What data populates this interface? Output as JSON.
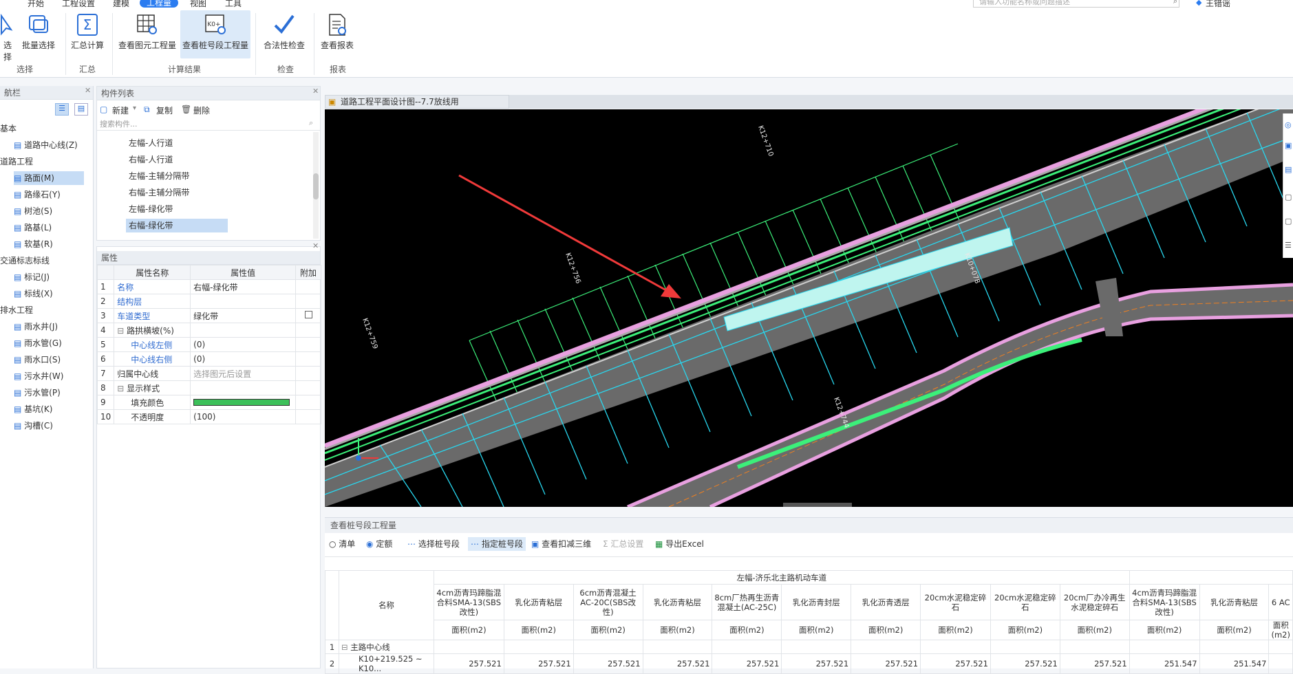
{
  "menu": {
    "items": [
      "开始",
      "工程设置",
      "建模",
      "工程量",
      "视图",
      "工具"
    ],
    "active_index": 3
  },
  "search": {
    "placeholder": "请输入功能名称或问题描述"
  },
  "user": {
    "name": "王错谣"
  },
  "ribbon": {
    "buttons": [
      "选择",
      "批量选择",
      "汇总计算",
      "查看图元工程量",
      "查看桩号段工程量",
      "合法性检查",
      "查看报表"
    ],
    "groups": [
      "选择",
      "汇总",
      "计算结果",
      "检查",
      "报表"
    ]
  },
  "nav": {
    "title": "航栏",
    "items": [
      {
        "label": "基本",
        "type": "category"
      },
      {
        "label": "道路中心线(Z)",
        "type": "item"
      },
      {
        "label": "道路工程",
        "type": "category"
      },
      {
        "label": "路面(M)",
        "type": "item",
        "selected": true
      },
      {
        "label": "路缘石(Y)",
        "type": "item"
      },
      {
        "label": "树池(S)",
        "type": "item"
      },
      {
        "label": "路基(L)",
        "type": "item"
      },
      {
        "label": "软基(R)",
        "type": "item"
      },
      {
        "label": "交通标志标线",
        "type": "category"
      },
      {
        "label": "标记(J)",
        "type": "item"
      },
      {
        "label": "标线(X)",
        "type": "item"
      },
      {
        "label": "排水工程",
        "type": "category"
      },
      {
        "label": "雨水井(J)",
        "type": "item"
      },
      {
        "label": "雨水管(G)",
        "type": "item"
      },
      {
        "label": "雨水口(S)",
        "type": "item"
      },
      {
        "label": "污水井(W)",
        "type": "item"
      },
      {
        "label": "污水管(P)",
        "type": "item"
      },
      {
        "label": "基坑(K)",
        "type": "item"
      },
      {
        "label": "沟槽(C)",
        "type": "item"
      }
    ]
  },
  "component_list": {
    "title": "构件列表",
    "new_label": "新建",
    "copy_label": "复制",
    "delete_label": "删除",
    "search_placeholder": "搜索构件...",
    "items": [
      "左幅-人行道",
      "右幅-人行道",
      "左幅-主辅分隔带",
      "右幅-主辅分隔带",
      "左幅-绿化带",
      "右幅-绿化带"
    ],
    "selected_index": 5
  },
  "properties": {
    "title": "属性",
    "headers": [
      "属性名称",
      "属性值",
      "附加"
    ],
    "rows": [
      {
        "no": "1",
        "name": "名称",
        "value": "右幅-绿化带",
        "blue": true
      },
      {
        "no": "2",
        "name": "结构层",
        "value": "",
        "blue": true
      },
      {
        "no": "3",
        "name": "车道类型",
        "value": "绿化带",
        "blue": true,
        "checkbox": true
      },
      {
        "no": "4",
        "name": "路拱横坡(%)",
        "value": "",
        "group": true
      },
      {
        "no": "5",
        "name": "中心线左侧",
        "value": "(0)",
        "blue": true,
        "indent": true
      },
      {
        "no": "6",
        "name": "中心线右侧",
        "value": "(0)",
        "blue": true,
        "indent": true
      },
      {
        "no": "7",
        "name": "归属中心线",
        "value": "选择图元后设置",
        "muted": true
      },
      {
        "no": "8",
        "name": "显示样式",
        "value": "",
        "group": true
      },
      {
        "no": "9",
        "name": "填充颜色",
        "value": "",
        "swatch": "#3cc05a",
        "indent": true
      },
      {
        "no": "10",
        "name": "不透明度",
        "value": "(100)",
        "indent": true
      }
    ]
  },
  "drawing": {
    "tab_title": "道路工程平面设计图--7.7放线用",
    "labels": [
      "K12+710",
      "K12+756",
      "K12+759",
      "K12+744",
      "K10+078"
    ]
  },
  "bottom": {
    "title": "查看桩号段工程量",
    "radio_list": "清单",
    "radio_quota": "定额",
    "select_station": "选择桩号段",
    "assign_station": "指定桩号段",
    "view_3d": "查看扣减三维",
    "summary_settings": "汇总设置",
    "export_excel": "导出Excel",
    "table": {
      "group_header": "左幅-济乐北主路机动车道",
      "name_header": "名称",
      "columns": [
        "4cm沥青玛蹄脂混合料SMA-13(SBS改性)",
        "乳化沥青粘层",
        "6cm沥青混凝土AC-20C(SBS改性)",
        "乳化沥青粘层",
        "8cm厂热再生沥青混凝土(AC-25C)",
        "乳化沥青封层",
        "乳化沥青透层",
        "20cm水泥稳定碎石",
        "20cm水泥稳定碎石",
        "20cm厂办冷再生水泥稳定碎石",
        "4cm沥青玛蹄脂混合料SMA-13(SBS改性)",
        "乳化沥青粘层",
        "6 AC"
      ],
      "unit": "面积(m2)",
      "rows": [
        {
          "no": "1",
          "name": "主路中心线",
          "values": []
        },
        {
          "no": "2",
          "name": "K10+219.525 ~ K10...",
          "values": [
            "257.521",
            "257.521",
            "257.521",
            "257.521",
            "257.521",
            "257.521",
            "257.521",
            "257.521",
            "257.521",
            "257.521",
            "251.547",
            "251.547"
          ]
        }
      ]
    }
  }
}
